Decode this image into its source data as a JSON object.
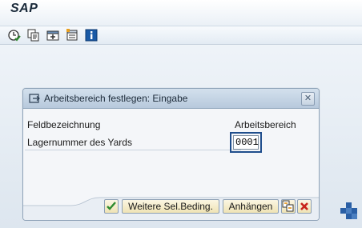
{
  "app": {
    "brand": "SAP"
  },
  "toolbar": {
    "icons": [
      "execute-icon",
      "copy-icon",
      "add-window-icon",
      "select-icon",
      "info-icon"
    ]
  },
  "dialog": {
    "title": "Arbeitsbereich festlegen: Eingabe",
    "field_header": "Feldbezeichnung",
    "value_header": "Arbeitsbereich",
    "field_label": "Lagernummer des Yards",
    "field_value": "0001",
    "buttons": {
      "more_conditions": "Weitere Sel.Beding.",
      "append": "Anhängen"
    }
  },
  "colors": {
    "accent": "#1f4e8c",
    "confirm_green": "#2e8b2e",
    "cancel_red": "#c8241c"
  }
}
